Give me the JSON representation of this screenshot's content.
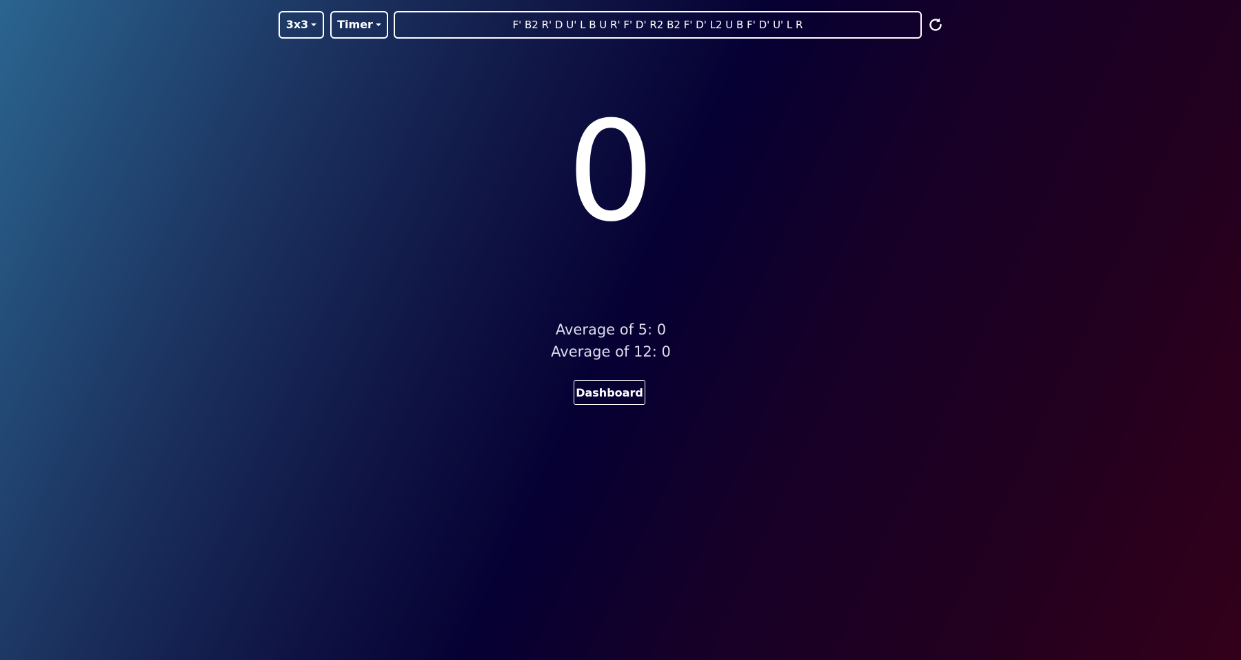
{
  "toolbar": {
    "puzzle_label": "3x3",
    "mode_label": "Timer",
    "scramble": "F' B2 R' D U' L B U R' F' D' R2 B2 F' D' L2 U B F' D' U' L R",
    "refresh_icon": "refresh-icon"
  },
  "timer": {
    "display": "0"
  },
  "stats": {
    "ao5": "Average of 5: 0",
    "ao12": "Average of 12: 0"
  },
  "actions": {
    "dashboard_label": "Dashboard"
  },
  "colors": {
    "text": "#ffffff",
    "bg_start": "#2b6590",
    "bg_mid": "#060033",
    "bg_end": "#33001a"
  }
}
